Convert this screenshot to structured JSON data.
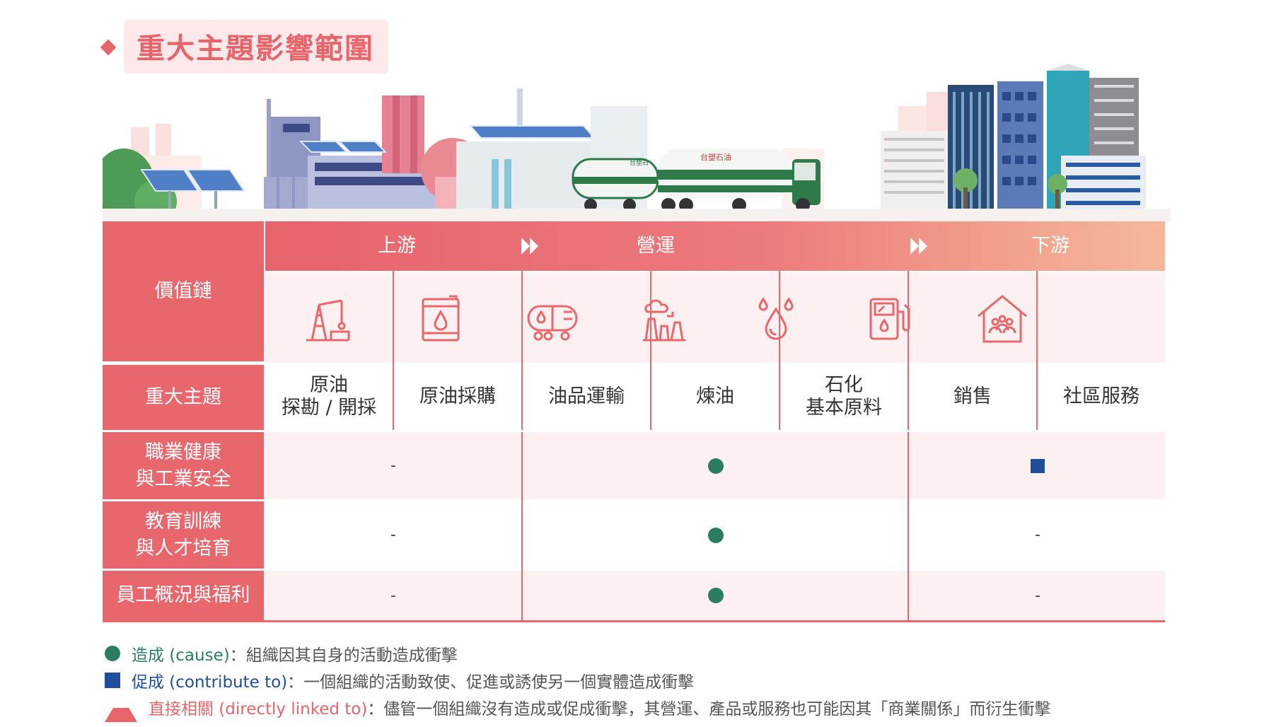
{
  "title": "重大主題影響範圍",
  "row_labels": {
    "value_chain": "價值鏈",
    "topic": "重大主題",
    "ohs": "職業健康\n與工業安全",
    "training": "教育訓練\n與人才培育",
    "welfare": "員工概況與福利"
  },
  "stages": {
    "upstream": "上游",
    "operations": "營運",
    "downstream": "下游"
  },
  "truck_logo": "台塑石油",
  "truck_logo_small": "台塑石",
  "icons": [
    "oil-rig-icon",
    "oil-barrel-icon",
    "tanker-truck-icon",
    "refinery-icon",
    "petrochemical-drops-icon",
    "gas-pump-icon",
    "community-house-icon"
  ],
  "topics": [
    "原油\n探勘 / 開採",
    "原油採購",
    "油品運輸",
    "煉油",
    "石化\n基本原料",
    "銷售",
    "社區服務"
  ],
  "impacts": {
    "ohs": {
      "upstream": "-",
      "operations": "cause",
      "downstream": "contribute"
    },
    "training": {
      "upstream": "-",
      "operations": "cause",
      "downstream": "-"
    },
    "welfare": {
      "upstream": "-",
      "operations": "cause",
      "downstream": "-"
    }
  },
  "dash": "-",
  "legend": [
    {
      "symbol": "circle",
      "term": "造成 (cause)",
      "desc": "：組織因其自身的活動造成衝擊"
    },
    {
      "symbol": "square",
      "term": "促成 (contribute to)",
      "desc": "：一個組織的活動致使、促進或誘使另一個實體造成衝擊"
    },
    {
      "symbol": "triangle",
      "term": "直接相關 (directly linked to)",
      "desc": "：儘管一個組織沒有造成或促成衝擊，其營運、產品或服務也可能因其「商業關係」而衍生衝擊"
    }
  ],
  "colors": {
    "accent": "#e8676d",
    "cause": "#2a7d5f",
    "contribute": "#1f4e9a",
    "linked": "#e8646b"
  }
}
